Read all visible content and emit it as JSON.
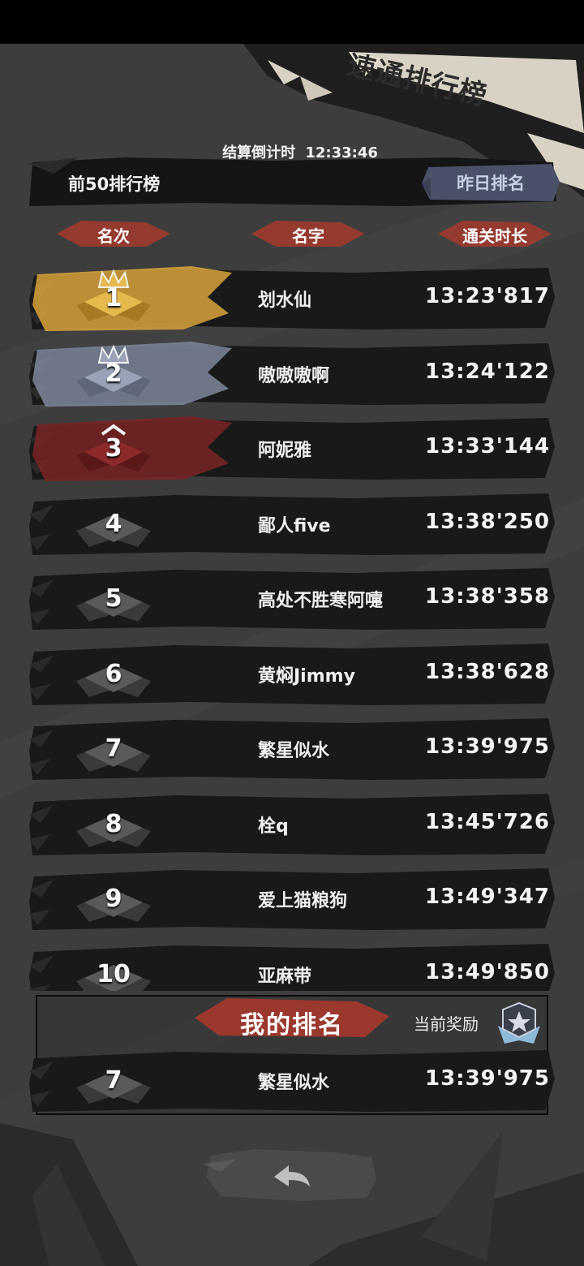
{
  "title": "速通排行榜",
  "countdown": {
    "label": "结算倒计时",
    "value": "12:33:46"
  },
  "header": {
    "title": "前50排行榜",
    "yesterday_button": "昨日排名"
  },
  "columns": {
    "rank": "名次",
    "name": "名字",
    "time": "通关时长"
  },
  "rows": [
    {
      "rank": "1",
      "name": "划水仙",
      "time": "13:23'817",
      "tier": "gold"
    },
    {
      "rank": "2",
      "name": "嗷嗷嗷啊",
      "time": "13:24'122",
      "tier": "silver"
    },
    {
      "rank": "3",
      "name": "阿妮雅",
      "time": "13:33'144",
      "tier": "bronze"
    },
    {
      "rank": "4",
      "name": "鄙人five",
      "time": "13:38'250",
      "tier": "normal"
    },
    {
      "rank": "5",
      "name": "高处不胜寒阿嚏",
      "time": "13:38'358",
      "tier": "normal"
    },
    {
      "rank": "6",
      "name": "黄焖Jimmy",
      "time": "13:38'628",
      "tier": "normal"
    },
    {
      "rank": "7",
      "name": "繁星似水",
      "time": "13:39'975",
      "tier": "normal"
    },
    {
      "rank": "8",
      "name": "栓q",
      "time": "13:45'726",
      "tier": "normal"
    },
    {
      "rank": "9",
      "name": "爱上猫粮狗",
      "time": "13:49'347",
      "tier": "normal"
    },
    {
      "rank": "10",
      "name": "亚麻带",
      "time": "13:49'850",
      "tier": "normal"
    }
  ],
  "my_rank": {
    "title": "我的排名",
    "reward_label": "当前奖励",
    "rank": "7",
    "name": "繁星似水",
    "time": "13:39'975"
  },
  "colors": {
    "background": "#3d3d3e",
    "gold": "#d9a43c",
    "silver": "#8e96ad",
    "bronze": "#8c2a2a",
    "header_red": "#a5392c",
    "button_blue": "#4a5067"
  },
  "icons": {
    "back": "back-arrow-icon",
    "reward": "reward-badge-icon",
    "crown": "crown-icon"
  }
}
